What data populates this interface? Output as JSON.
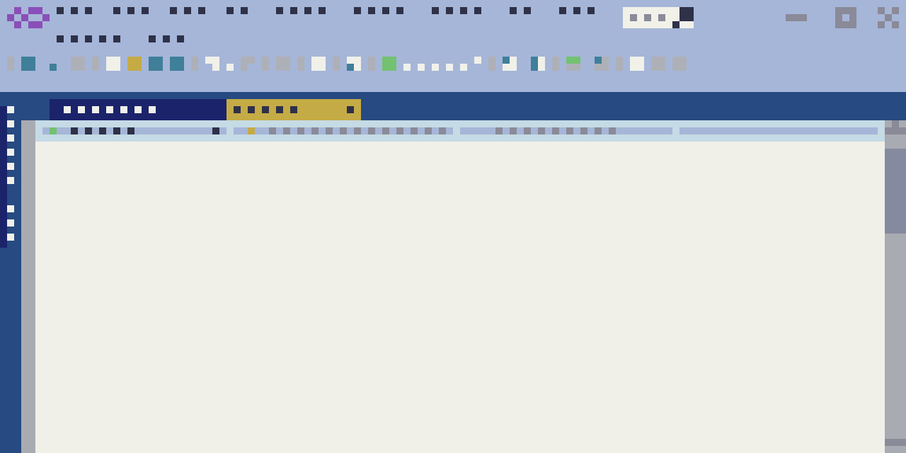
{
  "window": {
    "logo": "app-logo",
    "controls": [
      "minimize",
      "maximize",
      "close"
    ]
  },
  "colors": {
    "chrome": "#a6b6d8",
    "tabbar": "#274a82",
    "active_tab": "#1b236b",
    "accent_tab": "#c5ab46",
    "header_strip": "#c5dbe5",
    "document": "#f0f0e9",
    "scrollbar": "#a9abb2"
  },
  "icons": [
    "app-logo-icon",
    "minimize-icon",
    "maximize-icon",
    "close-icon",
    "dropdown-icon"
  ],
  "scroll": {
    "position": 0.12
  }
}
